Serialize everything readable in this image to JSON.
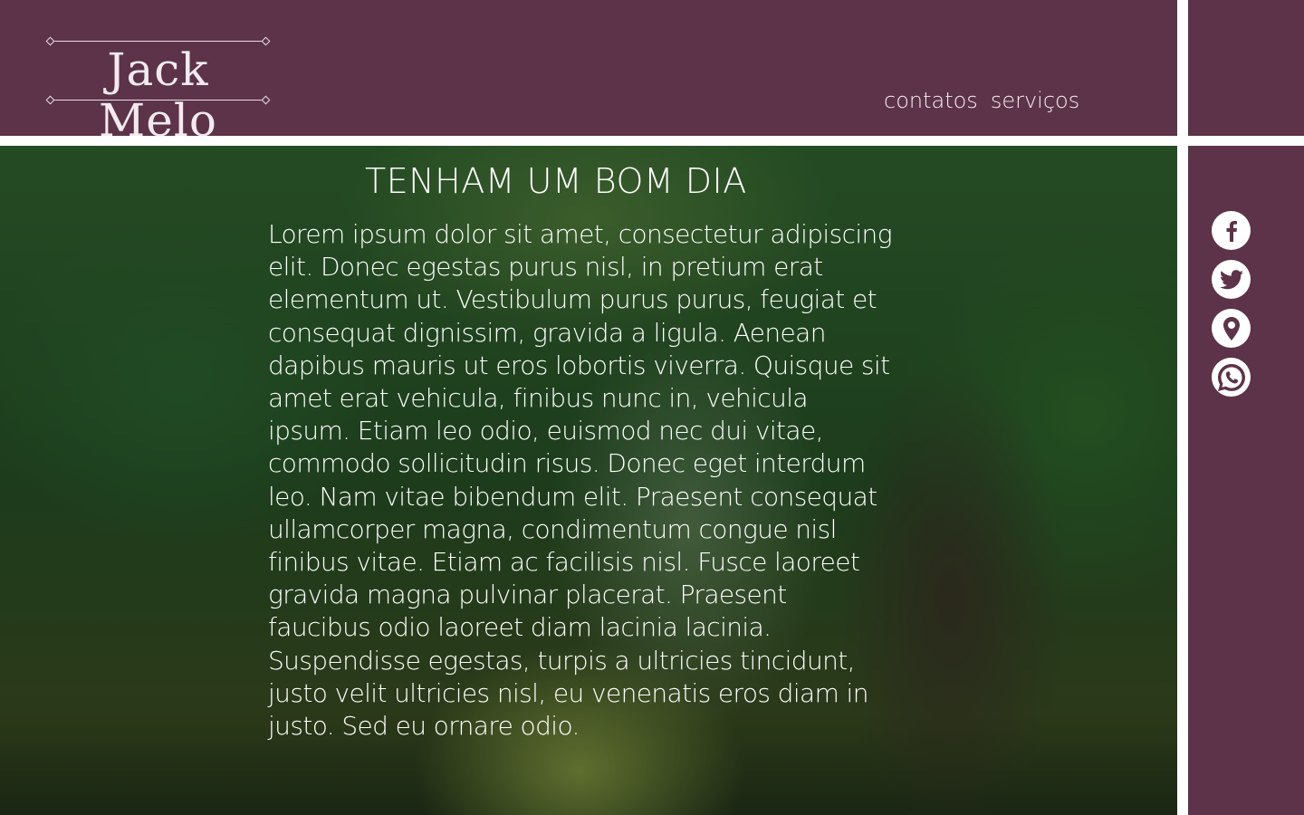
{
  "header": {
    "logo_text": "Jack Melo",
    "nav": [
      {
        "label": "contatos"
      },
      {
        "label": "serviços"
      }
    ]
  },
  "hero": {
    "title": "TENHAM UM BOM DIA",
    "body": "Lorem ipsum dolor sit amet, consectetur adipiscing elit. Donec egestas purus nisl, in pretium erat elementum ut. Vestibulum purus purus, feugiat et consequat dignissim, gravida a ligula. Aenean dapibus mauris ut eros lobortis viverra. Quisque sit amet erat vehicula, finibus nunc in, vehicula ipsum. Etiam leo odio, euismod nec dui vitae, commodo sollicitudin risus. Donec eget interdum leo. Nam vitae bibendum elit. Praesent consequat ullamcorper magna, condimentum congue nisl finibus vitae. Etiam ac facilisis nisl. Fusce laoreet gravida magna pulvinar placerat. Praesent faucibus odio laoreet diam lacinia lacinia. Suspendisse egestas, turpis a ultricies tincidunt, justo velit ultricies nisl, eu venenatis eros diam in justo. Sed eu ornare odio."
  },
  "social": [
    {
      "icon": "facebook-icon"
    },
    {
      "icon": "twitter-icon"
    },
    {
      "icon": "location-pin-icon"
    },
    {
      "icon": "whatsapp-icon"
    }
  ],
  "colors": {
    "brand_purple": "#5d3349",
    "text_light": "#ffffff"
  }
}
